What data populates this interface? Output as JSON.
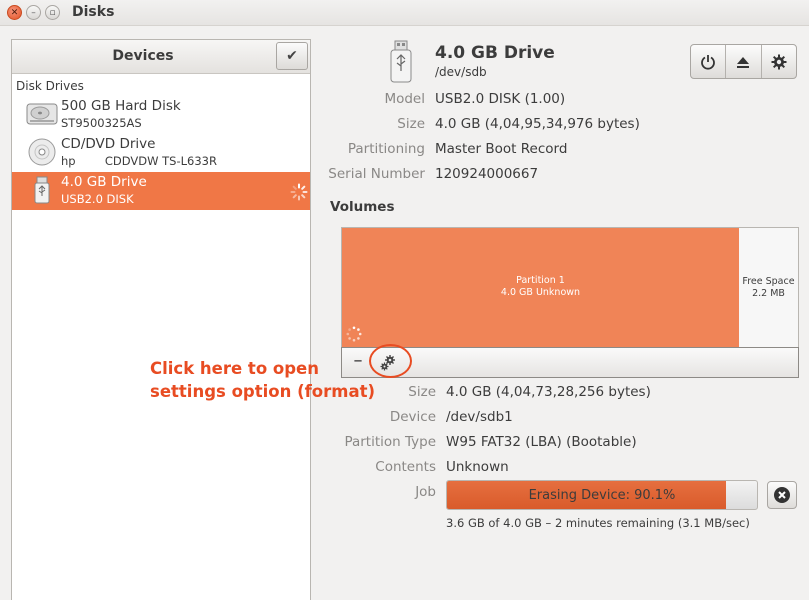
{
  "window": {
    "title": "Disks"
  },
  "sidebar": {
    "title": "Devices",
    "section": "Disk Drives",
    "devices": [
      {
        "name": "500 GB Hard Disk",
        "sub": "ST9500325AS",
        "icon": "hard-disk-icon",
        "selected": false
      },
      {
        "name": "CD/DVD Drive",
        "sub": "hp        CDDVDW TS-L633R",
        "icon": "optical-drive-icon",
        "selected": false
      },
      {
        "name": "4.0 GB Drive",
        "sub": "USB2.0 DISK",
        "icon": "usb-drive-icon",
        "selected": true
      }
    ]
  },
  "drive": {
    "title": "4.0 GB Drive",
    "path": "/dev/sdb",
    "fields": [
      {
        "label": "Model",
        "value": "USB2.0 DISK (1.00)"
      },
      {
        "label": "Size",
        "value": "4.0 GB (4,04,95,34,976 bytes)"
      },
      {
        "label": "Partitioning",
        "value": "Master Boot Record"
      },
      {
        "label": "Serial Number",
        "value": "120924000667"
      }
    ]
  },
  "volumes": {
    "heading": "Volumes",
    "partition": {
      "name": "Partition 1",
      "desc": "4.0 GB Unknown"
    },
    "free": {
      "name": "Free Space",
      "size": "2.2 MB"
    },
    "minus_label": "–"
  },
  "volume_details": [
    {
      "label": "Size",
      "value": "4.0 GB (4,04,73,28,256 bytes)"
    },
    {
      "label": "Device",
      "value": "/dev/sdb1"
    },
    {
      "label": "Partition Type",
      "value": "W95 FAT32 (LBA) (Bootable)"
    },
    {
      "label": "Contents",
      "value": "Unknown"
    }
  ],
  "job": {
    "label": "Job",
    "progress_text": "Erasing Device: 90.1%",
    "progress_fraction": 0.901,
    "detail": "3.6 GB of 4.0 GB – 2 minutes remaining (3.1 MB/sec)"
  },
  "annotation": {
    "line1": "Click here to open",
    "line2": "settings option (format)",
    "color": "#e84c22"
  },
  "colors": {
    "accent": "#f07746",
    "partition": "#f08457"
  }
}
